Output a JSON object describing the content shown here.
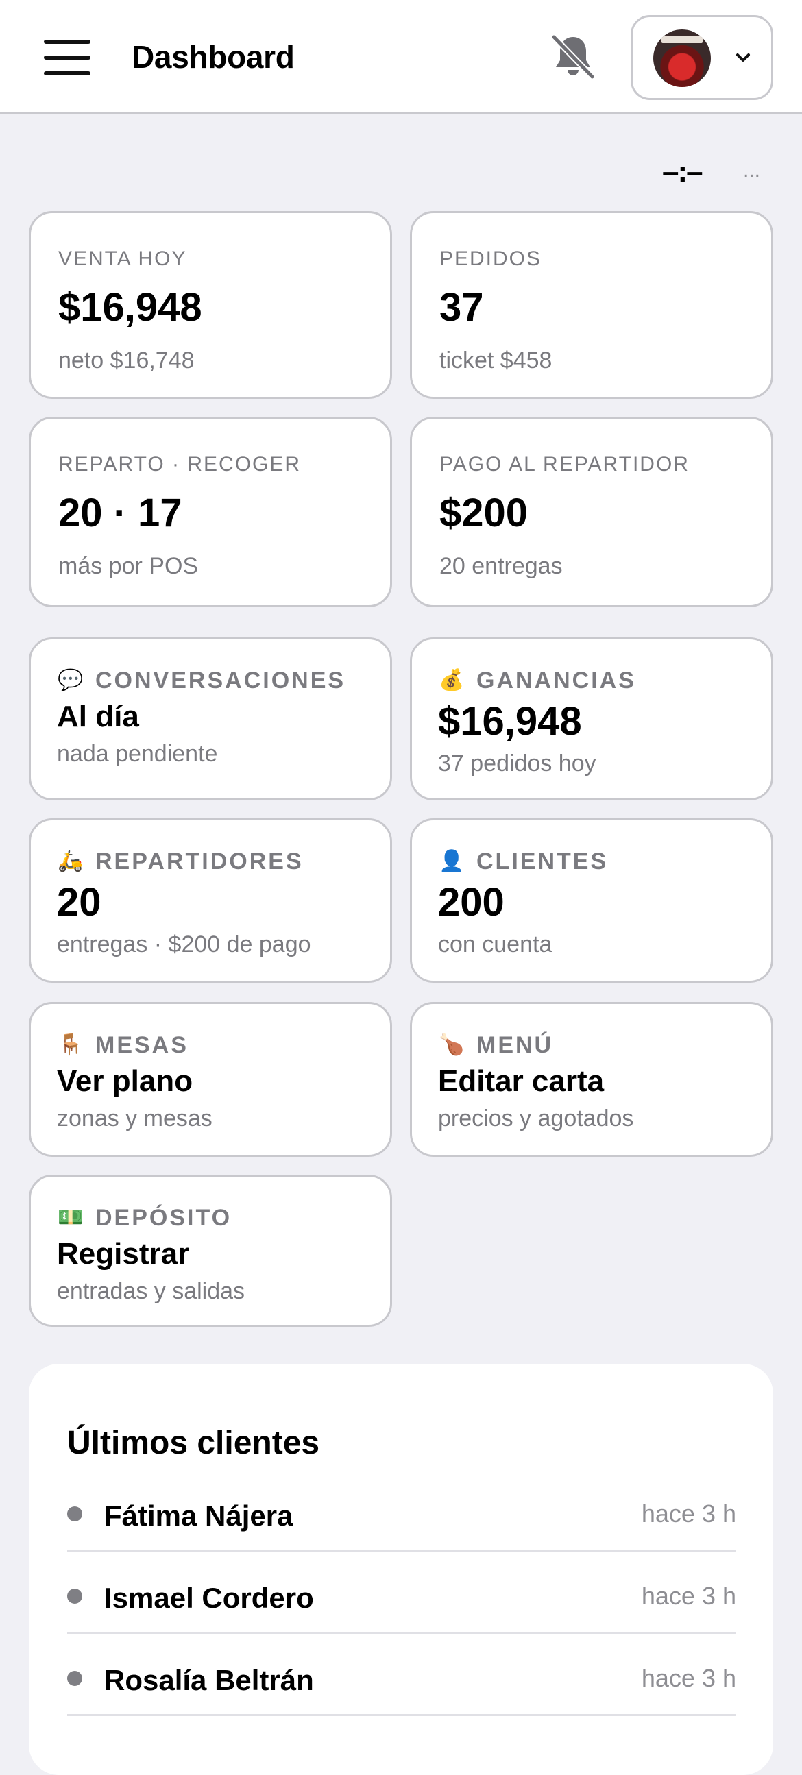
{
  "header": {
    "menu_icon": "hamburger-menu-icon",
    "title": "Dashboard",
    "bell_icon": "bell-off-icon",
    "avatar_icon": "user-avatar",
    "chevron_icon": "chevron-down-icon"
  },
  "indicator": {
    "text": "–:–",
    "more": "..."
  },
  "stats": [
    {
      "label": "VENTA HOY",
      "value": "$16,948",
      "sub": "neto $16,748"
    },
    {
      "label": "PEDIDOS",
      "value": "37",
      "sub": "ticket $458"
    },
    {
      "label": "REPARTO · RECOGER",
      "value": "20 · 17",
      "sub": "más por POS"
    },
    {
      "label": "PAGO AL REPARTIDOR",
      "value": "$200",
      "sub": "20 entregas"
    }
  ],
  "tiles": [
    {
      "icon": "💬",
      "icon_name": "speech-bubble-icon",
      "label": "CONVERSACIONES",
      "value": "Al día",
      "sub": "nada pendiente"
    },
    {
      "icon": "💰",
      "icon_name": "money-bag-icon",
      "label": "GANANCIAS",
      "value": "$16,948",
      "sub": "37 pedidos hoy"
    },
    {
      "icon": "🛵",
      "icon_name": "scooter-icon",
      "label": "REPARTIDORES",
      "value": "20",
      "sub": "entregas · $200 de pago"
    },
    {
      "icon": "👤",
      "icon_name": "user-icon",
      "label": "CLIENTES",
      "value": "200",
      "sub": "con cuenta"
    },
    {
      "icon": "🪑",
      "icon_name": "chair-icon",
      "label": "MESAS",
      "value": "Ver plano",
      "sub": "zonas y mesas"
    },
    {
      "icon": "🍗",
      "icon_name": "drumstick-icon",
      "label": "MENÚ",
      "value": "Editar carta",
      "sub": "precios y agotados"
    },
    {
      "icon": "💵",
      "icon_name": "banknote-icon",
      "label": "DEPÓSITO",
      "value": "Registrar",
      "sub": "entradas y salidas"
    }
  ],
  "recent": {
    "title": "Últimos clientes",
    "items": [
      {
        "name": "Fátima Nájera",
        "time": "hace 3 h"
      },
      {
        "name": "Ismael Cordero",
        "time": "hace 3 h"
      },
      {
        "name": "Rosalía Beltrán",
        "time": "hace 3 h"
      }
    ]
  }
}
